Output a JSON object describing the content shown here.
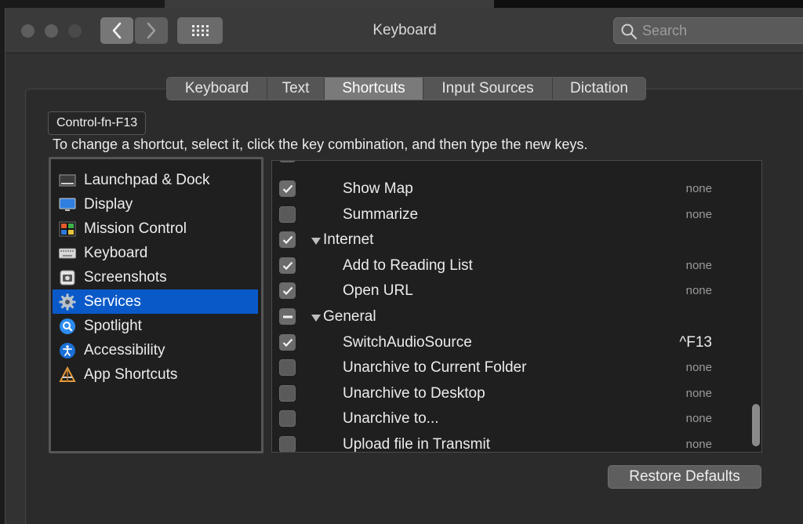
{
  "window": {
    "title": "Keyboard"
  },
  "search": {
    "placeholder": "Search"
  },
  "tabs": [
    {
      "label": "Keyboard",
      "active": false
    },
    {
      "label": "Text",
      "active": false
    },
    {
      "label": "Shortcuts",
      "active": true
    },
    {
      "label": "Input Sources",
      "active": false
    },
    {
      "label": "Dictation",
      "active": false
    }
  ],
  "tooltip": {
    "text": "Control-fn-F13"
  },
  "instruction": {
    "text": "To change a shortcut, select it, click the key combination, and then type the new keys."
  },
  "sidebar": {
    "items": [
      {
        "label": "Launchpad & Dock",
        "icon": "launchpad-dock-icon",
        "selected": false
      },
      {
        "label": "Display",
        "icon": "display-icon",
        "selected": false
      },
      {
        "label": "Mission Control",
        "icon": "mission-control-icon",
        "selected": false
      },
      {
        "label": "Keyboard",
        "icon": "keyboard-icon",
        "selected": false
      },
      {
        "label": "Screenshots",
        "icon": "screenshots-icon",
        "selected": false
      },
      {
        "label": "Services",
        "icon": "gear-icon",
        "selected": true
      },
      {
        "label": "Spotlight",
        "icon": "spotlight-icon",
        "selected": false
      },
      {
        "label": "Accessibility",
        "icon": "accessibility-icon",
        "selected": false
      },
      {
        "label": "App Shortcuts",
        "icon": "app-shortcuts-icon",
        "selected": false
      }
    ]
  },
  "shortcuts": {
    "rows": [
      {
        "label": "Show Map",
        "shortcut": "none",
        "checked": "on",
        "group": false
      },
      {
        "label": "Summarize",
        "shortcut": "none",
        "checked": "off",
        "group": false
      },
      {
        "label": "Internet",
        "shortcut": "",
        "checked": "on",
        "group": true
      },
      {
        "label": "Add to Reading List",
        "shortcut": "none",
        "checked": "on",
        "group": false
      },
      {
        "label": "Open URL",
        "shortcut": "none",
        "checked": "on",
        "group": false
      },
      {
        "label": "General",
        "shortcut": "",
        "checked": "mixed",
        "group": true
      },
      {
        "label": "SwitchAudioSource",
        "shortcut": "^F13",
        "checked": "on",
        "group": false
      },
      {
        "label": "Unarchive to Current Folder",
        "shortcut": "none",
        "checked": "off",
        "group": false
      },
      {
        "label": "Unarchive to Desktop",
        "shortcut": "none",
        "checked": "off",
        "group": false
      },
      {
        "label": "Unarchive to...",
        "shortcut": "none",
        "checked": "off",
        "group": false
      },
      {
        "label": "Upload file in Transmit",
        "shortcut": "none",
        "checked": "off",
        "group": false
      }
    ]
  },
  "buttons": {
    "restore_defaults": "Restore Defaults"
  },
  "colors": {
    "selection": "#0a59c9",
    "window_bg": "#323232",
    "list_bg": "#1f1f1f"
  }
}
